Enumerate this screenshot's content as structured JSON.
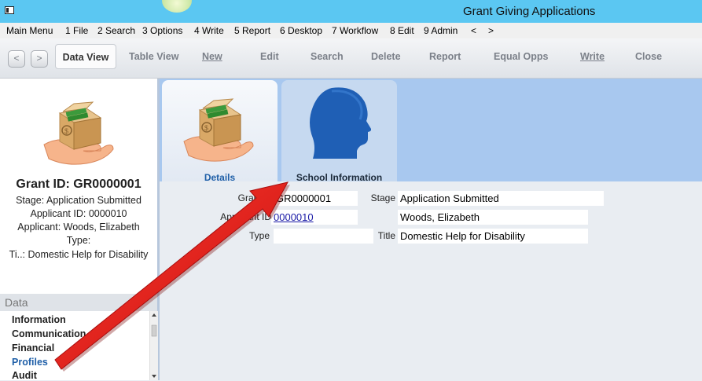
{
  "window": {
    "title": "Grant Giving Applications"
  },
  "menubar": {
    "items": [
      "Main Menu",
      "1 File",
      "2 Search",
      "3 Options",
      "4 Write",
      "5 Report",
      "6 Desktop",
      "7 Workflow",
      "8 Edit",
      "9 Admin"
    ],
    "prev": "<",
    "next": ">"
  },
  "toolbar": {
    "back": "<",
    "forward": ">",
    "data_view": "Data View",
    "table_view": "Table View",
    "new": "New",
    "edit": "Edit",
    "search": "Search",
    "delete": "Delete",
    "report": "Report",
    "equal_opps": "Equal Opps",
    "write": "Write",
    "close": "Close"
  },
  "summary": {
    "grant_id": "Grant ID: GR0000001",
    "stage": "Stage: Application Submitted",
    "applicant_id": "Applicant ID: 0000010",
    "applicant": "Applicant: Woods, Elizabeth",
    "type": "Type:",
    "title": "Ti..: Domestic Help for Disability"
  },
  "data_panel": {
    "header": "Data",
    "items": [
      "Information",
      "Communication",
      "Financial",
      "Profiles",
      "Audit"
    ]
  },
  "tabs": [
    {
      "label": "Details",
      "icon": "grant-box-hand-icon"
    },
    {
      "label": "School Information",
      "icon": "head-silhouette-icon"
    }
  ],
  "form": {
    "grant_id_label": "Grant ID",
    "grant_id": "GR0000001",
    "stage_label": "Stage",
    "stage": "Application Submitted",
    "applicant_id_label": "Applicant ID",
    "applicant_id": "0000010",
    "applicant_name": "Woods, Elizabeth",
    "type_label": "Type",
    "type": "",
    "title_label": "Title",
    "title": "Domestic Help for Disability"
  },
  "colors": {
    "titlebar": "#5bc7f2",
    "tabstrip": "#a8c8ef",
    "annotation_arrow": "#e21b1b"
  }
}
